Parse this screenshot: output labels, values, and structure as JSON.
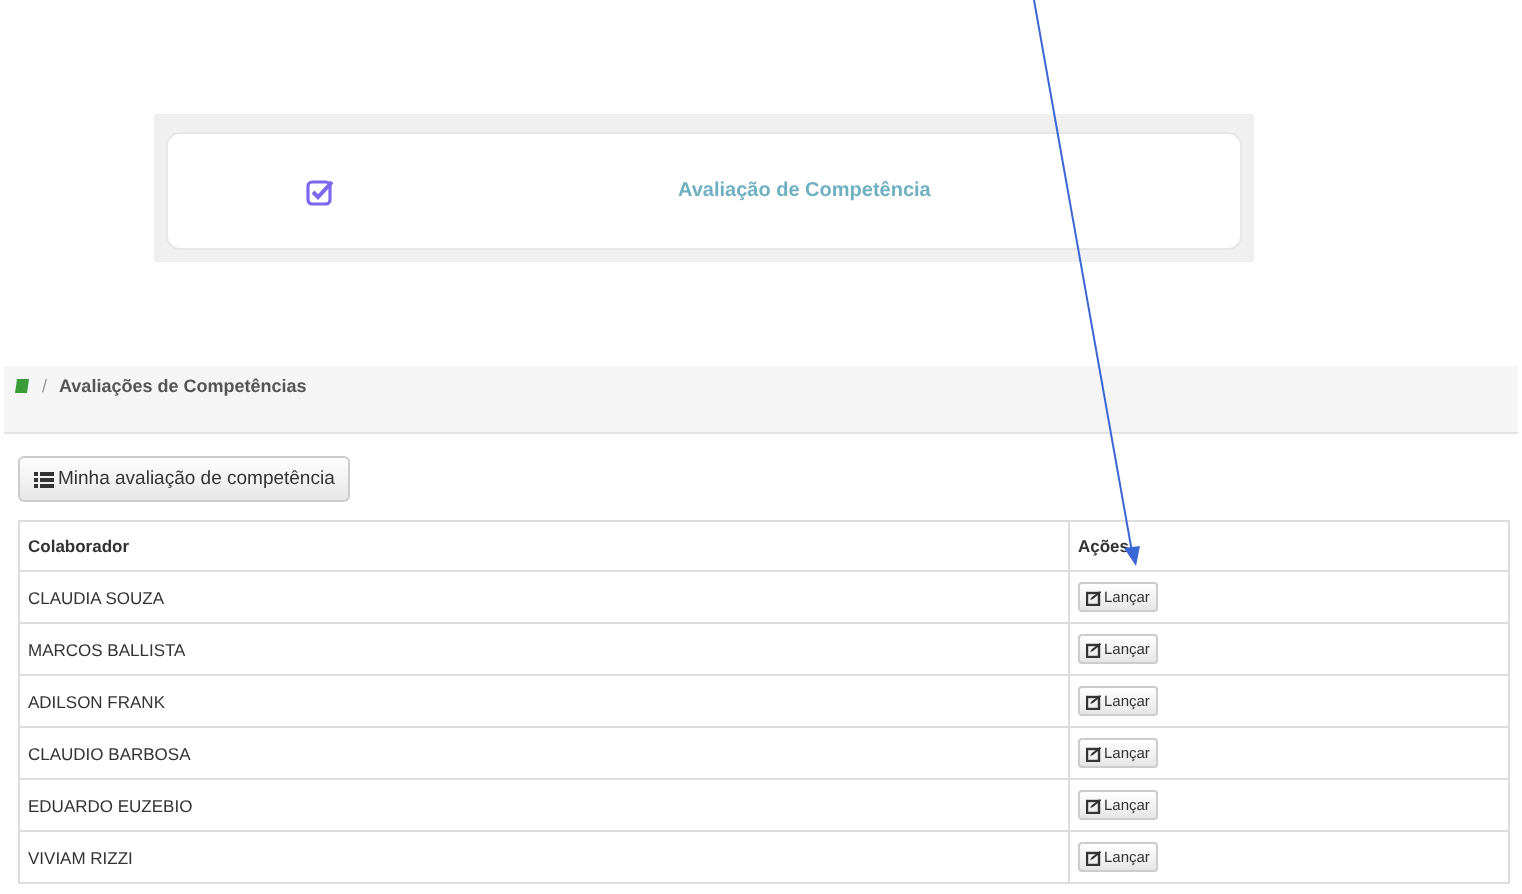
{
  "card": {
    "title": "Avaliação de Competência"
  },
  "breadcrumb": {
    "separator": "/",
    "current": "Avaliações de Competências"
  },
  "list_button": {
    "label": "Minha avaliação de competência"
  },
  "table": {
    "columns": [
      "Colaborador",
      "Ações"
    ],
    "rows": [
      {
        "name": "CLAUDIA SOUZA",
        "action": "Lançar"
      },
      {
        "name": "MARCOS BALLISTA",
        "action": "Lançar"
      },
      {
        "name": "ADILSON FRANK",
        "action": "Lançar"
      },
      {
        "name": "CLAUDIO BARBOSA",
        "action": "Lançar"
      },
      {
        "name": "EDUARDO EUZEBIO",
        "action": "Lançar"
      },
      {
        "name": "VIVIAM RIZZI",
        "action": "Lançar"
      }
    ]
  }
}
